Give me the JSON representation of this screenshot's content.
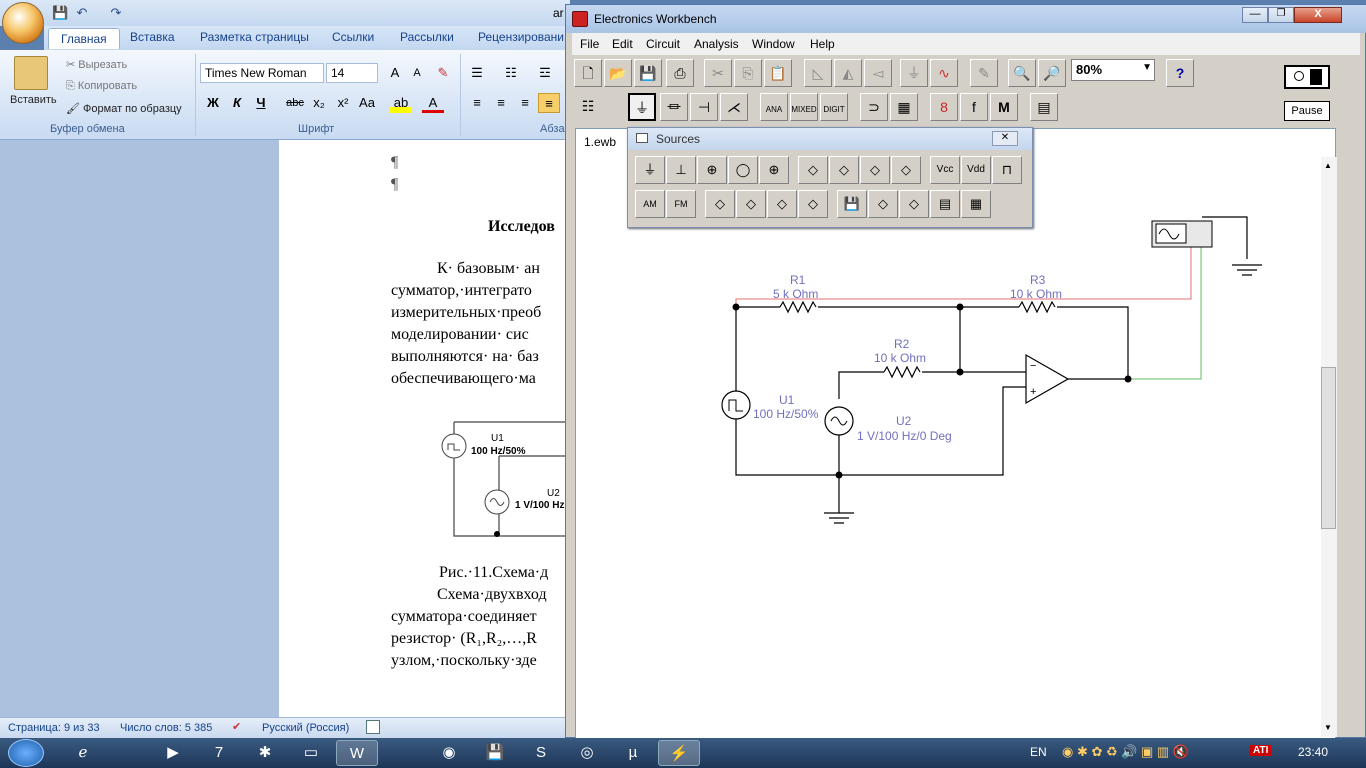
{
  "word": {
    "quick_access": [
      "💾",
      "↶",
      "↷"
    ],
    "tabs": [
      "Главная",
      "Вставка",
      "Разметка страницы",
      "Ссылки",
      "Рассылки",
      "Рецензировани"
    ],
    "clipboard": {
      "paste": "Вставить",
      "cut": "Вырезать",
      "copy": "Копировать",
      "format": "Формат по образцу",
      "group": "Буфер обмена"
    },
    "font": {
      "name": "Times New Roman",
      "size": "14",
      "group": "Шрифт",
      "bold": "Ж",
      "italic": "К",
      "underline": "Ч",
      "strike": "abc",
      "sub": "x₂",
      "sup": "x²",
      "case": "Aa"
    },
    "para_group": "Абза",
    "title_fragment": "ar",
    "body": {
      "pilcrow": "¶",
      "heading": "Исследов",
      "lines": [
        "К· базовым· ан",
        "сумматор,·интеграто",
        "измерительных·преоб",
        "моделировании· сис",
        "выполняются· на· баз",
        "обеспечивающего·ма"
      ],
      "fig_u1": "U1",
      "fig_u1_val": "100 Hz/50%",
      "fig_u2": "U2",
      "fig_u2_val": "1 V/100 Hz",
      "caption": "Рис.·11.Схема·д",
      "lines2": [
        "Схема·двухвход",
        "сумматора·соединяет",
        "резистор· (R₁,R₂,…,R",
        "узлом,·поскольку·зде"
      ]
    },
    "status": {
      "page": "Страница: 9 из 33",
      "words": "Число слов: 5 385",
      "lang": "Русский (Россия)"
    }
  },
  "ewb": {
    "title": "Electronics Workbench",
    "menu": [
      "File",
      "Edit",
      "Circuit",
      "Analysis",
      "Window",
      "Help"
    ],
    "zoom": "80%",
    "pause": "Pause",
    "doc_tab": "1.ewb",
    "parts_labels": [
      "ANA",
      "MIXED",
      "DIGIT"
    ],
    "sources_title": "Sources",
    "sources_labels": {
      "vcc": "Vcc",
      "vdd": "Vdd",
      "am": "AM",
      "fm": "FM"
    },
    "circuit": {
      "r1": "R1",
      "r1_val": "5 k Ohm",
      "r2": "R2",
      "r2_val": "10 k Ohm",
      "r3": "R3",
      "r3_val": "10 k Ohm",
      "u1": "U1",
      "u1_val": "100 Hz/50%",
      "u2": "U2",
      "u2_val": "1 V/100 Hz/0 Deg"
    }
  },
  "taskbar": {
    "lang": "EN",
    "time": "23:40",
    "ati": "ATI"
  }
}
